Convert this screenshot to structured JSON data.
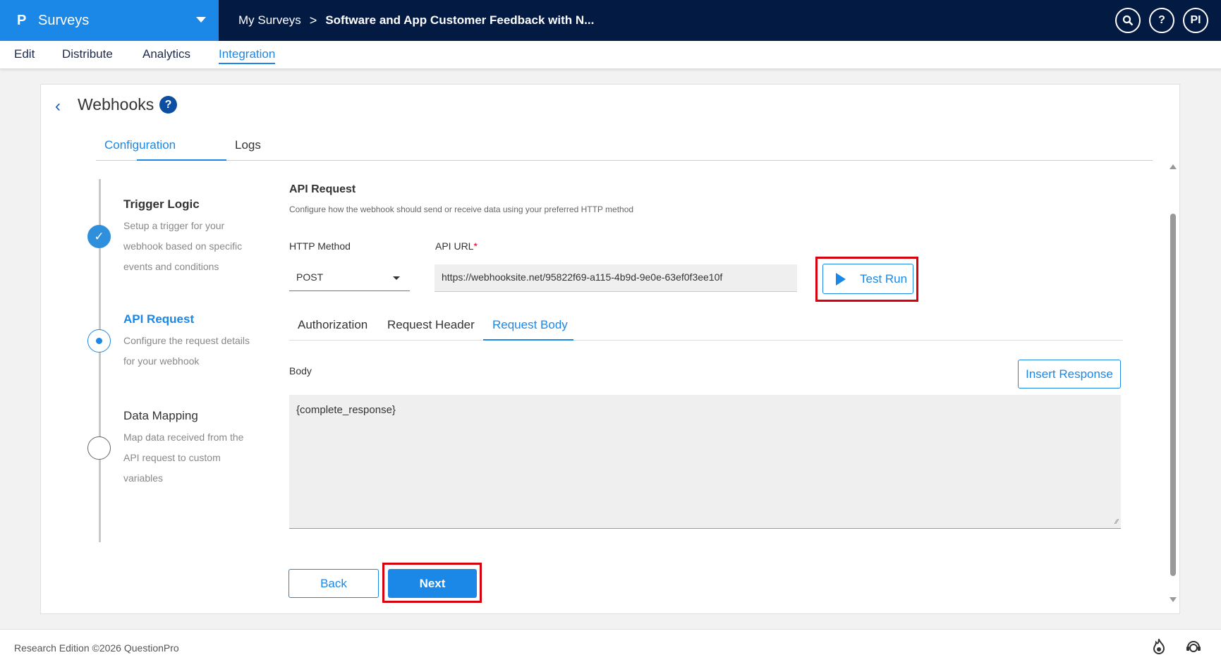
{
  "app": {
    "logo": "P",
    "name": "Surveys"
  },
  "breadcrumb": {
    "root": "My Surveys",
    "separator": ">",
    "current": "Software and App Customer Feedback with N..."
  },
  "header_icons": {
    "search": "search-icon",
    "help": "?",
    "profile": "PI"
  },
  "subnav": [
    "Edit",
    "Distribute",
    "Analytics",
    "Integration"
  ],
  "page": {
    "title": "Webhooks",
    "help": "?",
    "tabs": [
      "Configuration",
      "Logs"
    ]
  },
  "steps": [
    {
      "title": "Trigger Logic",
      "desc": "Setup a trigger for your webhook based on specific events and conditions",
      "state": "done"
    },
    {
      "title": "API Request",
      "desc": "Configure the request details for your webhook",
      "state": "active"
    },
    {
      "title": "Data Mapping",
      "desc": "Map data received from the API request to custom variables",
      "state": "pending"
    }
  ],
  "api_request": {
    "title": "API Request",
    "description": "Configure how the webhook should send or receive data using your preferred HTTP method",
    "http_method_label": "HTTP Method",
    "http_method_value": "POST",
    "api_url_label": "API URL",
    "required_mark": "*",
    "api_url_value": "https://webhooksite.net/95822f69-a115-4b9d-9e0e-63ef0f3ee10f",
    "test_run": "Test Run",
    "tabs": [
      "Authorization",
      "Request Header",
      "Request Body"
    ],
    "body_label": "Body",
    "insert_response": "Insert Response",
    "body_value": "{complete_response}"
  },
  "actions": {
    "back": "Back",
    "next": "Next"
  },
  "footer": {
    "copyright": "Research Edition ©2026 QuestionPro"
  },
  "colors": {
    "accent": "#1b87e6",
    "topbar": "#031a43",
    "highlight": "#d9000d"
  }
}
